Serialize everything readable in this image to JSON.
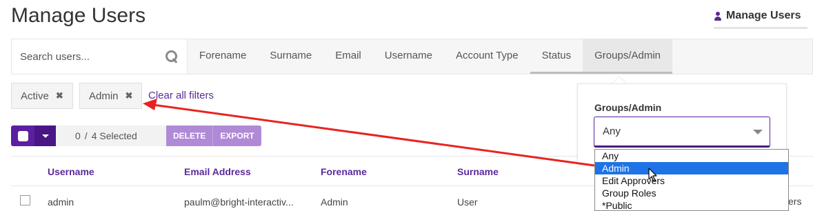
{
  "page": {
    "title": "Manage Users"
  },
  "header": {
    "manage_users_link": "Manage Users"
  },
  "search": {
    "placeholder": "Search users..."
  },
  "filter_tabs": [
    "Forename",
    "Surname",
    "Email",
    "Username",
    "Account Type",
    "Status",
    "Groups/Admin"
  ],
  "active_filters": [
    {
      "label": "Active",
      "remove_icon": "close-icon"
    },
    {
      "label": "Admin",
      "remove_icon": "close-icon"
    }
  ],
  "clear_filters": "Clear all filters",
  "selection": {
    "selected": "0",
    "separator": "/",
    "total": "4 Selected"
  },
  "actions": {
    "delete": "DELETE",
    "export": "EXPORT"
  },
  "table": {
    "columns": [
      "Username",
      "Email Address",
      "Forename",
      "Surname"
    ],
    "rows": [
      {
        "username": "admin",
        "email": "paulm@bright-interactiv...",
        "forename": "Admin",
        "surname": "User",
        "trailing": "ers"
      }
    ]
  },
  "groups_popover": {
    "label": "Groups/Admin",
    "selected": "Any",
    "options": [
      "Any",
      "Admin",
      "Edit Approvers",
      "Group Roles",
      "*Public"
    ],
    "highlighted": "Admin"
  },
  "colors": {
    "accent": "#5b1fa0",
    "link": "#5a2a9a",
    "highlight": "#1e73e6",
    "annotation_arrow": "#e8231f"
  }
}
